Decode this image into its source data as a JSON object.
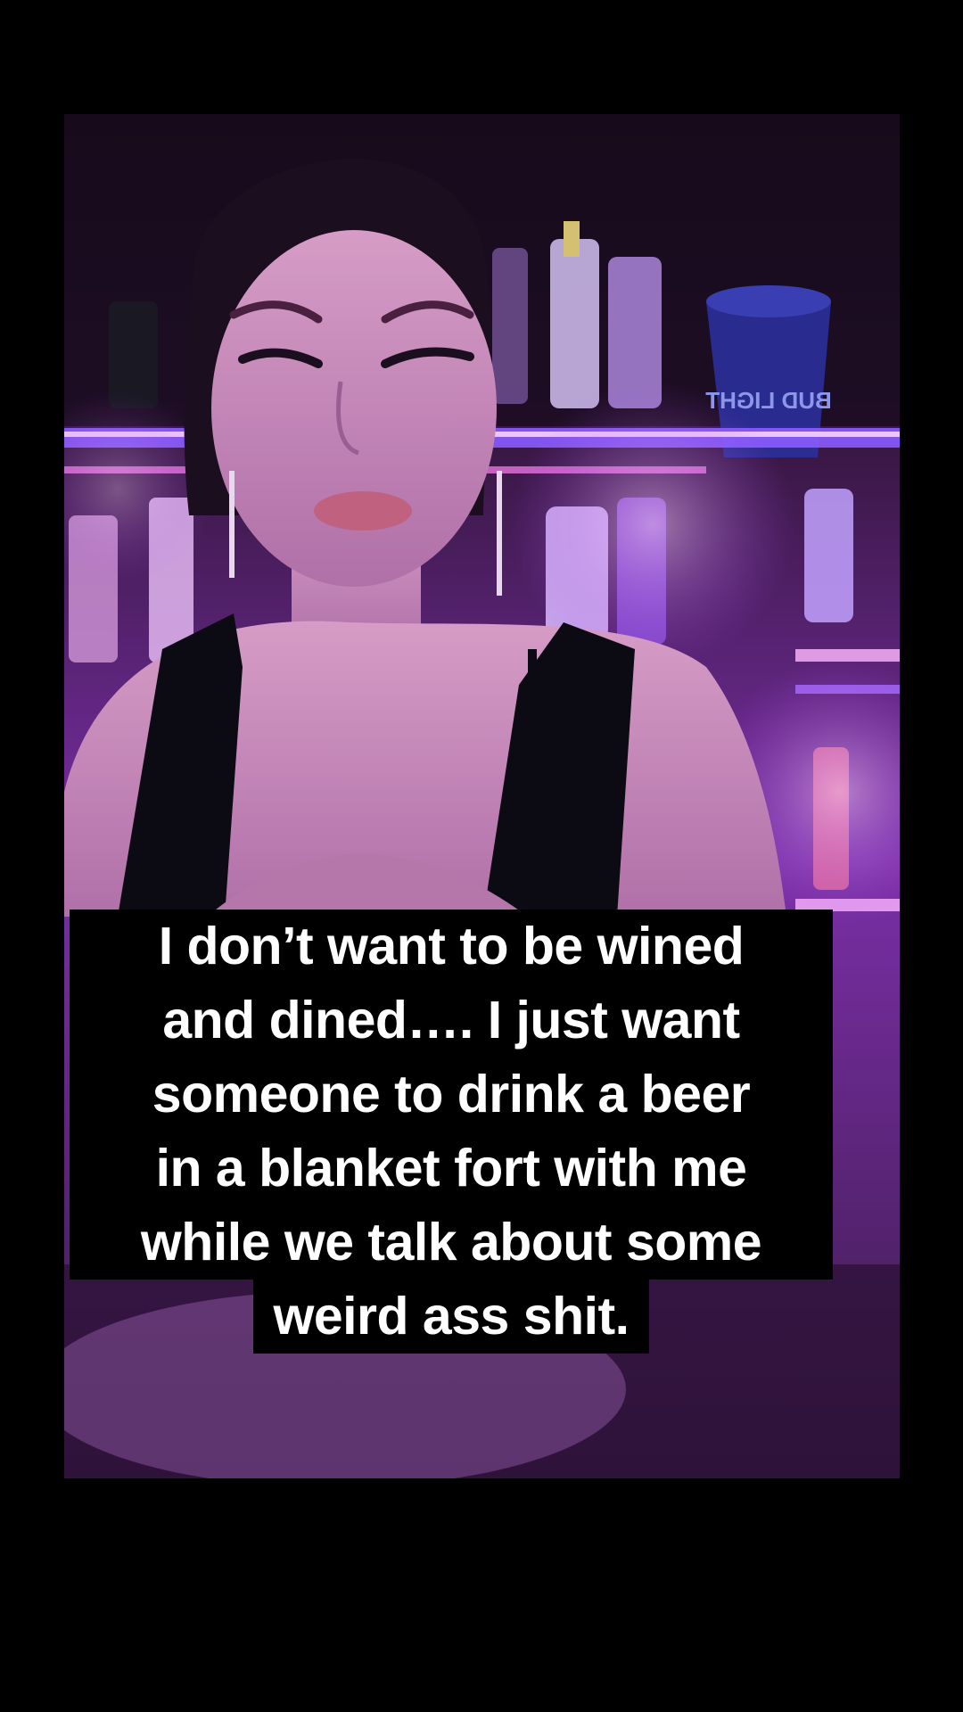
{
  "caption": {
    "lines": [
      "I don’t want to be wined",
      "and dined…. I just want",
      "someone to drink a beer",
      "in a blanket fort with me",
      "while we talk about some",
      "weird ass shit."
    ]
  },
  "scene": {
    "sign_text": "BUD LIGHT",
    "colors": {
      "background": "#000000",
      "neon_purple": "#c86bff",
      "neon_blue": "#5a46ff",
      "skin": "#c88ab8",
      "top": "#0c0a12"
    }
  }
}
